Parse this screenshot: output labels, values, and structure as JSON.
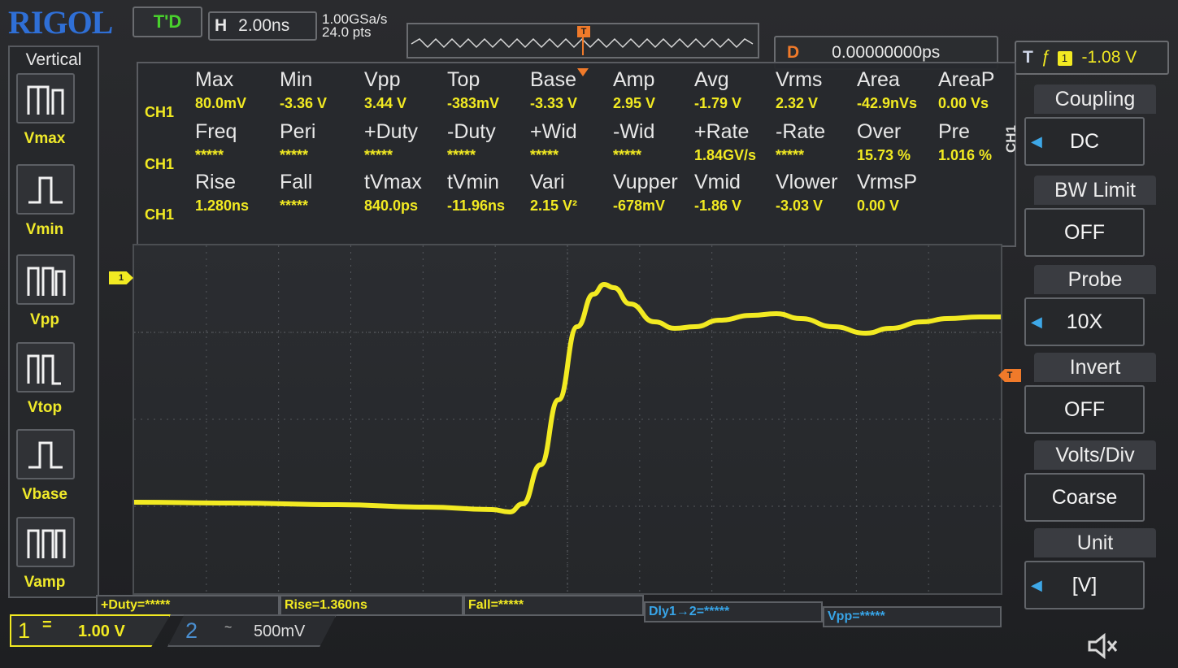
{
  "header": {
    "logo": "RIGOL",
    "run_state": "T'D",
    "timebase_label": "H",
    "timebase_value": "2.00ns",
    "sample_rate": "1.00GSa/s",
    "memory_depth": "24.0  pts",
    "delay_label": "D",
    "delay_value": "0.00000000ps",
    "trigger_label": "T",
    "trigger_source": "1",
    "trigger_level": "-1.08 V"
  },
  "left_menu": {
    "title": "Vertical",
    "items": [
      {
        "label": "Vmax",
        "icon": "vmax-pulse-icon"
      },
      {
        "label": "Vmin",
        "icon": "vmin-pulse-icon"
      },
      {
        "label": "Vpp",
        "icon": "vpp-pulse-icon"
      },
      {
        "label": "Vtop",
        "icon": "vtop-pulse-icon"
      },
      {
        "label": "Vbase",
        "icon": "vbase-pulse-icon"
      },
      {
        "label": "Vamp",
        "icon": "vamp-pulse-icon"
      }
    ]
  },
  "measurements": {
    "rows": [
      {
        "channel": "CH1",
        "names": [
          "Max",
          "Min",
          "Vpp",
          "Top",
          "Base",
          "Amp",
          "Avg",
          "Vrms",
          "Area",
          "AreaP"
        ],
        "values": [
          "80.0mV",
          "-3.36 V",
          "3.44 V",
          "-383mV",
          "-3.33 V",
          "2.95 V",
          "-1.79 V",
          "2.32 V",
          "-42.9nVs",
          "0.00 Vs"
        ]
      },
      {
        "channel": "CH1",
        "names": [
          "Freq",
          "Peri",
          "+Duty",
          "-Duty",
          "+Wid",
          "-Wid",
          "+Rate",
          "-Rate",
          "Over",
          "Pre"
        ],
        "values": [
          "*****",
          "*****",
          "*****",
          "*****",
          "*****",
          "*****",
          "1.84GV/s",
          "*****",
          "15.73 %",
          "1.016 %"
        ]
      },
      {
        "channel": "CH1",
        "names": [
          "Rise",
          "Fall",
          "tVmax",
          "tVmin",
          "Vari",
          "Vupper",
          "Vmid",
          "Vlower",
          "VrmsP",
          ""
        ],
        "values": [
          "1.280ns",
          "*****",
          "840.0ps",
          "-11.96ns",
          "2.15 V²",
          "-678mV",
          "-1.86 V",
          "-3.03 V",
          "0.00 V",
          ""
        ]
      }
    ]
  },
  "markers": {
    "ch1_ground": "1",
    "trigger_level": "T"
  },
  "quick_measures": [
    "+Duty=*****",
    "Rise=1.360ns",
    "Fall=*****",
    "Dly1→2=*****",
    "Vpp=*****"
  ],
  "channels": {
    "ch1": {
      "number": "1",
      "coupling_symbol": "=",
      "scale": "1.00 V"
    },
    "ch2": {
      "number": "2",
      "coupling_symbol": "~",
      "scale": "500mV"
    }
  },
  "right_menu": {
    "side_label": "CH1",
    "items": [
      {
        "title": "Coupling",
        "value": "DC"
      },
      {
        "title": "BW Limit",
        "value": "OFF"
      },
      {
        "title": "Probe",
        "value": "10X"
      },
      {
        "title": "Invert",
        "value": "OFF"
      },
      {
        "title": "Volts/Div",
        "value": "Coarse"
      },
      {
        "title": "Unit",
        "value": "[V]"
      }
    ]
  },
  "colors": {
    "ch1": "#f2ea22",
    "ch2": "#4a8fd0",
    "trigger": "#f07a2a",
    "logo": "#2f6fd6",
    "run_state": "#49d12d"
  },
  "waveform": {
    "description_of_signal": "",
    "volts_per_div": 1.0,
    "time_per_div_ns": 2.0,
    "baseline_v": -3.33,
    "top_v": -0.38,
    "peak_v": 0.08
  }
}
